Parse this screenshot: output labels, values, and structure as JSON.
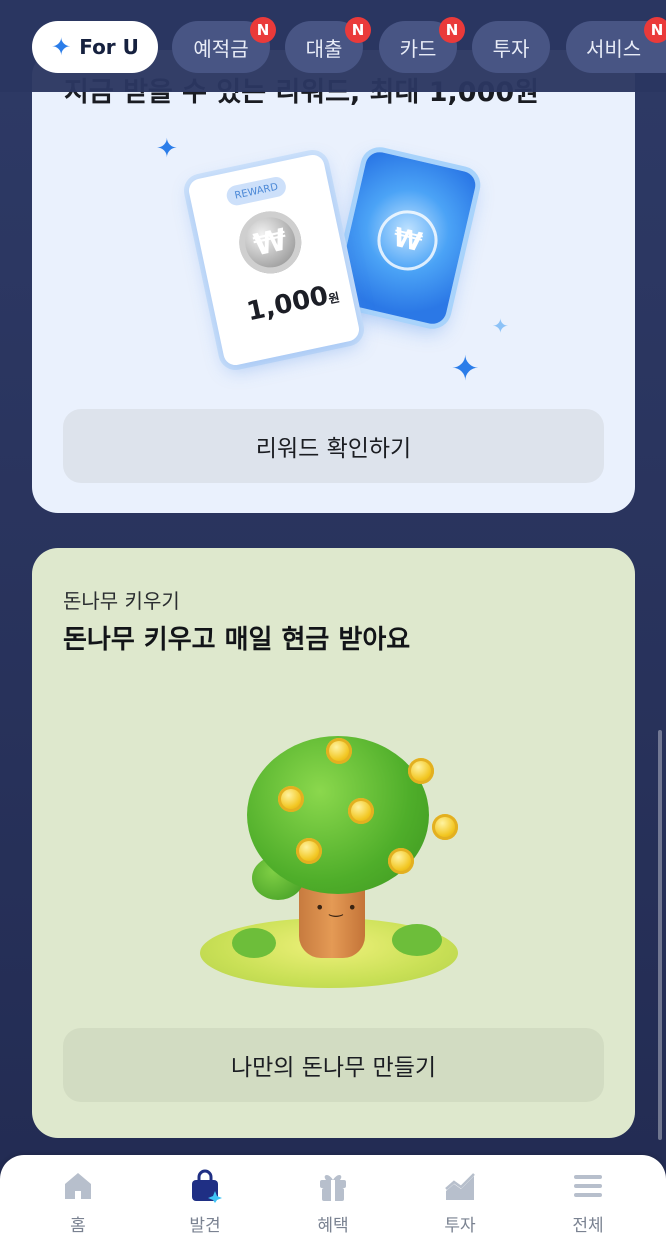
{
  "tabs": [
    {
      "label": "For U",
      "active": true,
      "icon": "sparkle-icon"
    },
    {
      "label": "예적금",
      "badge": "N"
    },
    {
      "label": "대출",
      "badge": "N"
    },
    {
      "label": "카드",
      "badge": "N"
    },
    {
      "label": "투자"
    },
    {
      "label": "서비스",
      "badge": "N"
    }
  ],
  "reward_card": {
    "title": "지금 받을 수 있는 리워드, 최대 1,000원",
    "pill": "REWARD",
    "coin_symbol": "₩",
    "amount": "1,000",
    "unit": "원",
    "button": "리워드 확인하기"
  },
  "tree_card": {
    "subtitle": "돈나무 키우기",
    "title": "돈나무 키우고 매일 현금 받아요",
    "button": "나만의 돈나무 만들기"
  },
  "bottom_nav": [
    {
      "label": "홈",
      "icon": "home-icon"
    },
    {
      "label": "발견",
      "icon": "shopping-bag-sparkle-icon",
      "active": true
    },
    {
      "label": "혜택",
      "icon": "gift-icon"
    },
    {
      "label": "투자",
      "icon": "chart-icon"
    },
    {
      "label": "전체",
      "icon": "menu-icon"
    }
  ],
  "colors": {
    "accent": "#2b7de9",
    "badge": "#ea3a3a",
    "active_nav": "#1f2f84"
  }
}
